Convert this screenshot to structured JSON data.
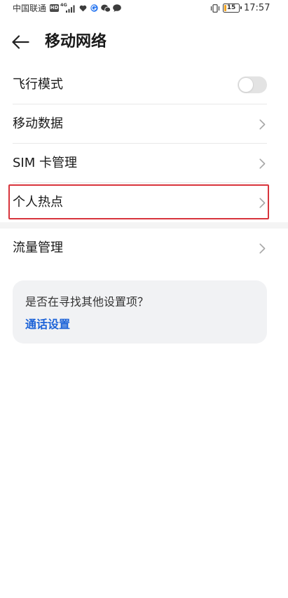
{
  "status_bar": {
    "carrier": "中国联通",
    "hd_badge": "HD",
    "network_type": "4G",
    "battery_level": "15",
    "time": "17:57",
    "icons": [
      "hd-icon",
      "signal-icon",
      "heart-icon",
      "browser-icon",
      "wechat-icon",
      "message-icon",
      "vibrate-icon",
      "battery-icon"
    ]
  },
  "header": {
    "title": "移动网络",
    "back_icon": "back-arrow-icon"
  },
  "settings": {
    "groups": [
      {
        "items": [
          {
            "label": "飞行模式",
            "trailing_icon": "toggle-icon",
            "enabled": false
          },
          {
            "label": "移动数据",
            "trailing_icon": "chevron-right-icon"
          },
          {
            "label": "SIM 卡管理",
            "trailing_icon": "chevron-right-icon"
          },
          {
            "label": "个人热点",
            "trailing_icon": "chevron-right-icon",
            "highlighted": true
          }
        ]
      },
      {
        "items": [
          {
            "label": "流量管理",
            "trailing_icon": "chevron-right-icon"
          }
        ]
      }
    ]
  },
  "suggestion_card": {
    "question": "是否在寻找其他设置项？",
    "link": "通话设置"
  },
  "colors": {
    "link": "#1d63d8",
    "highlight": "#d8343c",
    "card_bg": "#f1f2f4",
    "divider": "#e8e8e8",
    "toggle_off": "#e3e3e3",
    "chevron": "#a6a6a6",
    "section_gap": "#f4f4f4",
    "battery_low": "#f0a21e"
  }
}
